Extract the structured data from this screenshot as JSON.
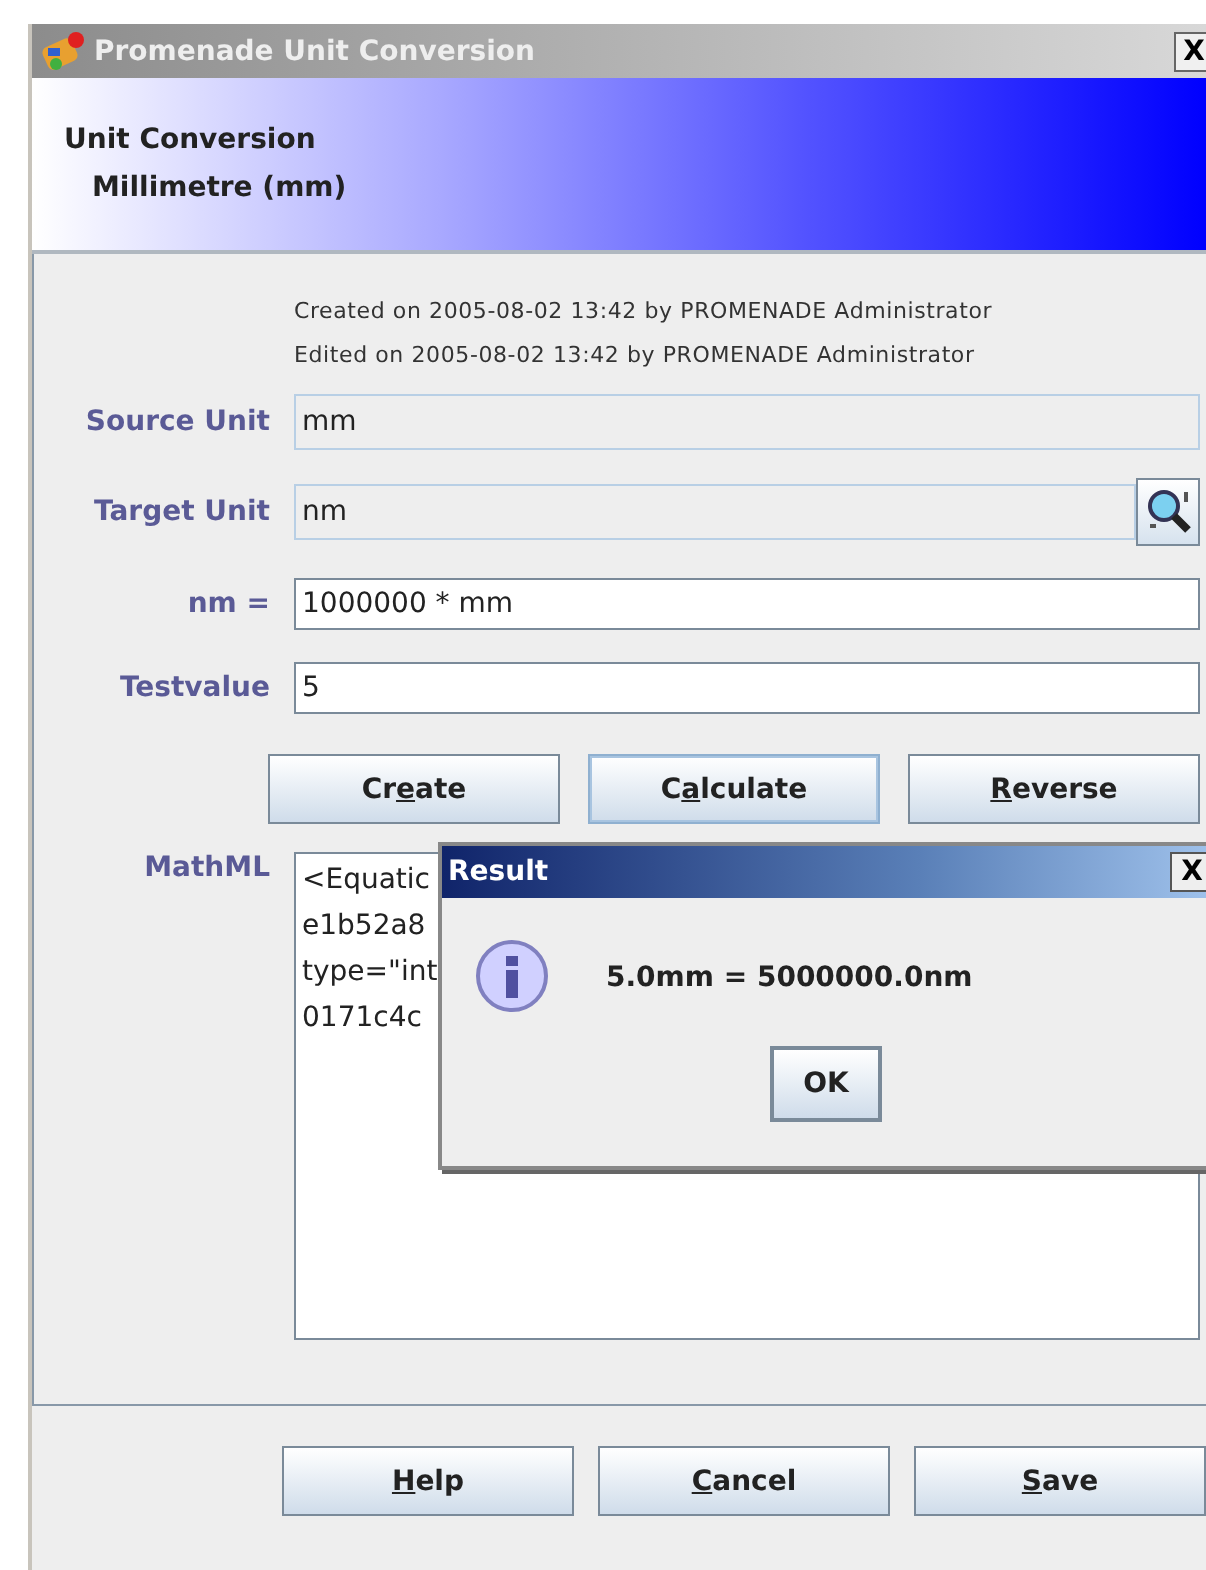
{
  "window": {
    "title": "Promenade Unit Conversion",
    "close": "X"
  },
  "header": {
    "title": "Unit Conversion",
    "subtitle": "Millimetre (mm)"
  },
  "meta": [
    "Created on 2005-08-02 13:42 by PROMENADE Administrator",
    "Edited on 2005-08-02 13:42 by PROMENADE Administrator"
  ],
  "fields": [
    {
      "label": "Source Unit",
      "value": "mm",
      "editable": false,
      "lookup": false
    },
    {
      "label": "Target Unit",
      "value": "nm",
      "editable": false,
      "lookup": true
    },
    {
      "label": "nm =",
      "value": "1000000 * mm",
      "editable": true,
      "lookup": false
    },
    {
      "label": "Testvalue",
      "value": "5",
      "editable": true,
      "lookup": false
    }
  ],
  "actions": [
    {
      "before": "Cr",
      "mnemonic": "e",
      "after": "ate",
      "focused": false
    },
    {
      "before": "C",
      "mnemonic": "a",
      "after": "lculate",
      "focused": true
    },
    {
      "mnemonic": "R",
      "after": "everse",
      "focused": false
    }
  ],
  "mathml": {
    "label": "MathML",
    "lines": [
      "<Equatic",
      "e1b52a8",
      "type=\"int",
      "0171c4c"
    ]
  },
  "footer_buttons": [
    {
      "mnemonic": "H",
      "after": "elp"
    },
    {
      "mnemonic": "C",
      "after": "ancel"
    },
    {
      "mnemonic": "S",
      "after": "ave"
    }
  ],
  "dialog": {
    "title": "Result",
    "close": "X",
    "message": "5.0mm = 5000000.0nm",
    "button": "OK"
  }
}
